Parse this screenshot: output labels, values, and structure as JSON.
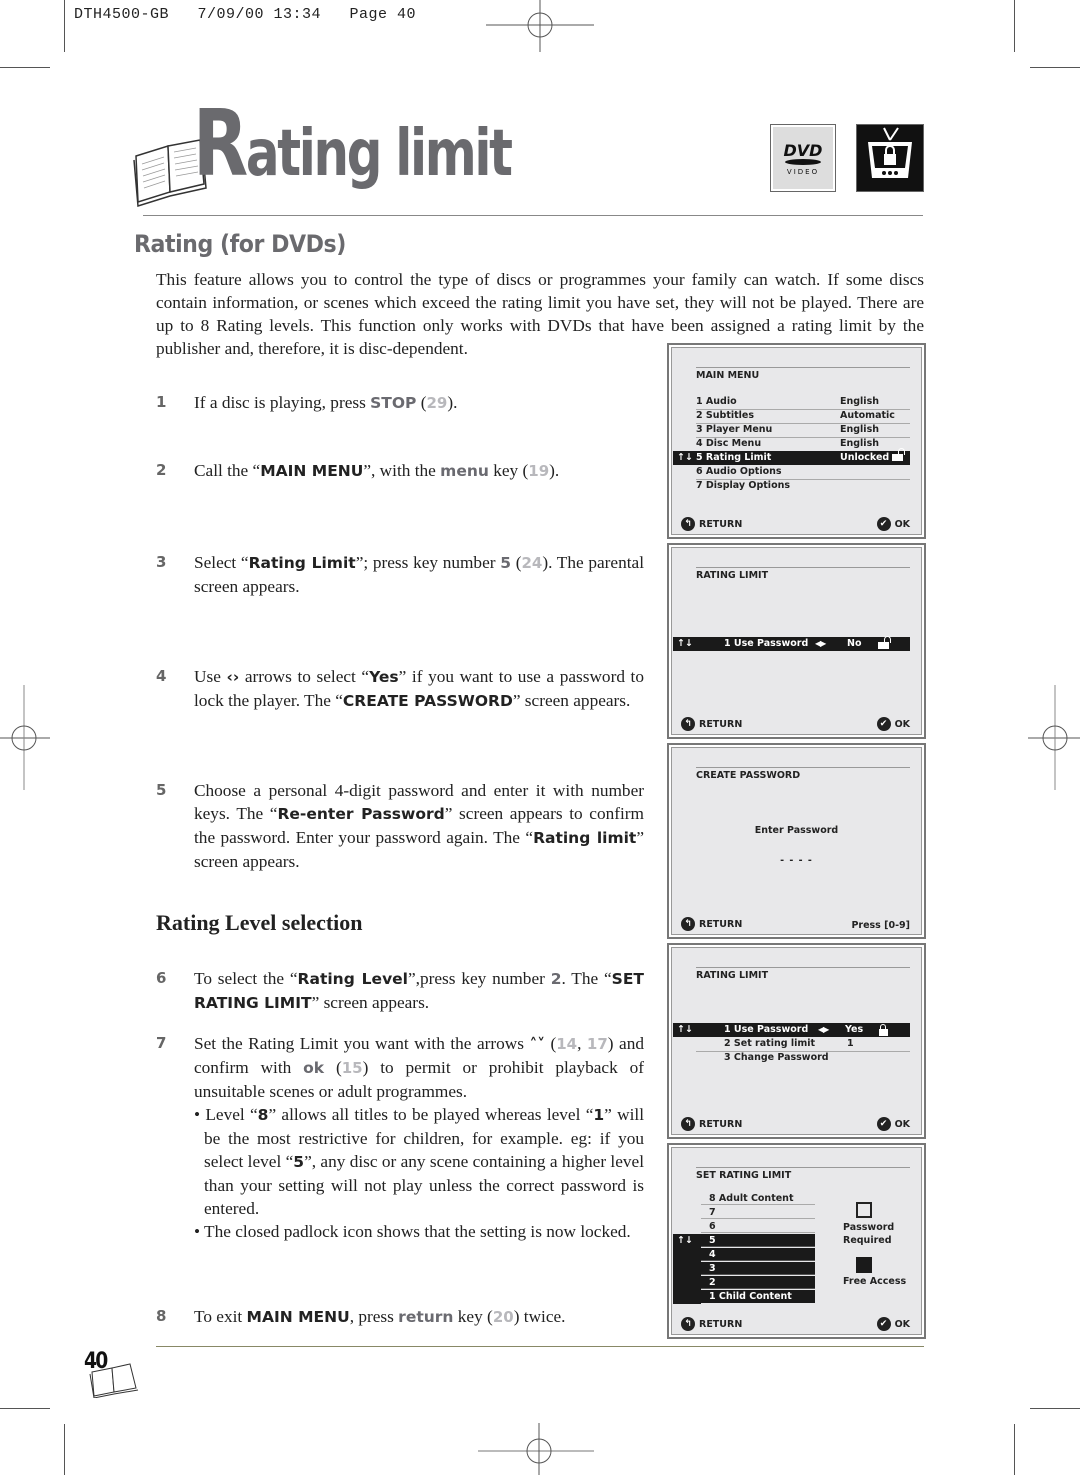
{
  "print_slug": "DTH4500-GB   7/09/00 13:34   Page 40",
  "header": {
    "title_initial": "R",
    "title_rest": "ating limit",
    "badges": [
      {
        "name": "dvd-video-logo",
        "line1": "DVD",
        "line2": "VIDEO"
      },
      {
        "name": "parental-lock-tv-icon"
      }
    ]
  },
  "section": {
    "title": "Rating (for DVDs)",
    "intro": "This feature allows you to control the type of discs or programmes your family can watch. If some discs contain information, or scenes which exceed the rating limit you have set, they will not be played. There are up to 8 Rating levels. This function only works with DVDs that have been assigned a rating limit by the publisher and, therefore, it is disc-dependent."
  },
  "steps": {
    "s1": {
      "num": "1",
      "a": "If a disc is playing, press ",
      "kw": "STOP",
      "b": " (",
      "ref": "29",
      "c": ")."
    },
    "s2": {
      "num": "2",
      "a": "Call the “",
      "kw": "MAIN MENU",
      "b": "”, with the ",
      "kw2": "menu",
      "c": " key (",
      "ref": "19",
      "d": ")."
    },
    "s3": {
      "num": "3",
      "a": "Select “",
      "kw": "Rating Limit",
      "b": "”; press key number ",
      "kw2": "5",
      "c": " (",
      "ref": "24",
      "d": "). The parental screen appears."
    },
    "s4": {
      "num": "4",
      "a": "Use ",
      "arrows": "‹›",
      "b": " arrows to select “",
      "kw": "Yes",
      "c": "” if you want to use a password to lock the player. The “",
      "kw2": "CREATE PASSWORD",
      "d": "” screen appears."
    },
    "s5": {
      "num": "5",
      "a": "Choose a personal 4-digit password and enter it with number keys. The “",
      "kw": "Re-enter Password",
      "b": "” screen appears to confirm the password. Enter your password again. The “",
      "kw2": "Rating limit",
      "c": "” screen appears."
    },
    "subhead": "Rating Level selection",
    "s6": {
      "num": "6",
      "a": "To select the “",
      "kw": "Rating Level",
      "b": "”,press key number ",
      "kw2": "2",
      "c": ". The “",
      "kw3": "SET RATING LIMIT",
      "d": "” screen appears."
    },
    "s7": {
      "num": "7",
      "a": "Set the Rating Limit you want with the arrows ",
      "arrows": "˄˅",
      "b": " (",
      "ref1": "14",
      "c": ", ",
      "ref2": "17",
      "d": ") and confirm with ",
      "kw": "ok",
      "e": " (",
      "ref3": "15",
      "f": ") to permit or prohibit playback of unsuitable scenes or adult programmes."
    },
    "bullet1": {
      "a": "• Level “",
      "kw": "8",
      "b": "” allows all titles to be played whereas level “",
      "kw2": "1",
      "c": "” will be the most restrictive for children, for example. eg: if you select level “",
      "kw3": "5",
      "d": "”, any disc or any scene containing a higher level than your setting will not play unless the correct password is entered."
    },
    "bullet2": "• The closed padlock icon shows that the setting is now locked.",
    "s8": {
      "num": "8",
      "a": "To exit ",
      "kw": "MAIN MENU",
      "b": ", press ",
      "kw2": "return",
      "c": " key (",
      "ref": "20",
      "d": ") twice."
    }
  },
  "screens": {
    "main_menu": {
      "title": "MAIN MENU",
      "items": [
        {
          "label": "1  Audio",
          "value": "English"
        },
        {
          "label": "2  Subtitles",
          "value": "Automatic"
        },
        {
          "label": "3  Player Menu",
          "value": "English"
        },
        {
          "label": "4  Disc Menu",
          "value": "English"
        },
        {
          "label": "5  Rating Limit",
          "value": "Unlocked",
          "selected": true
        },
        {
          "label": "6  Audio Options",
          "value": ""
        },
        {
          "label": "7  Display Options",
          "value": ""
        }
      ],
      "return_label": "RETURN",
      "ok_label": "OK"
    },
    "rating_limit_1": {
      "title": "RATING LIMIT",
      "row_label": "1 Use Password",
      "row_value": "No",
      "return_label": "RETURN",
      "ok_label": "OK"
    },
    "create_password": {
      "title": "CREATE PASSWORD",
      "prompt": "Enter Password",
      "placeholder": "- - - -",
      "return_label": "RETURN",
      "hint": "Press [0-9]"
    },
    "rating_limit_2": {
      "title": "RATING LIMIT",
      "items": [
        {
          "label": "1  Use Password",
          "value": "Yes",
          "selected": true
        },
        {
          "label": "2  Set rating limit",
          "value": "1"
        },
        {
          "label": "3  Change Password",
          "value": ""
        }
      ],
      "return_label": "RETURN",
      "ok_label": "OK"
    },
    "set_rating_limit": {
      "title": "SET RATING LIMIT",
      "levels": [
        "8 Adult Content",
        "7",
        "6",
        "5",
        "4",
        "3",
        "2",
        "1 Child Content"
      ],
      "selected_level": "5",
      "legend_required": "Password Required",
      "legend_free": "Free Access",
      "return_label": "RETURN",
      "ok_label": "OK"
    }
  },
  "footer": {
    "page_number": "40"
  }
}
